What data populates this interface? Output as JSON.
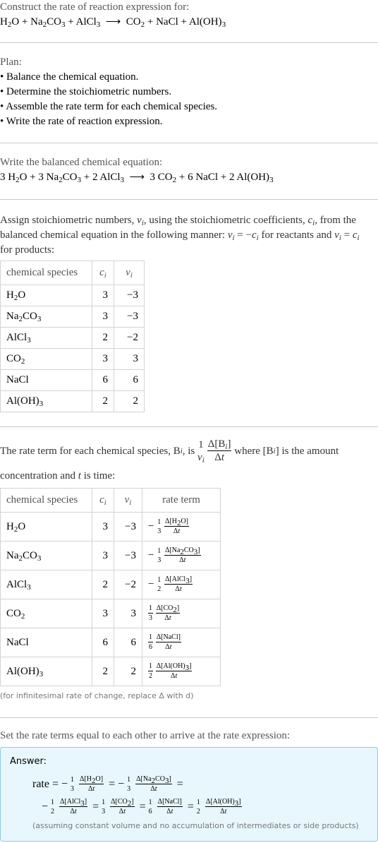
{
  "header": {
    "title": "Construct the rate of reaction expression for:",
    "reaction": {
      "reactants": [
        "H2O",
        "Na2CO3",
        "AlCl3"
      ],
      "products": [
        "CO2",
        "NaCl",
        "Al(OH)3"
      ],
      "arrow": "⟶"
    }
  },
  "plan": {
    "label": "Plan:",
    "steps": [
      "Balance the chemical equation.",
      "Determine the stoichiometric numbers.",
      "Assemble the rate term for each chemical species.",
      "Write the rate of reaction expression."
    ]
  },
  "balanced": {
    "label": "Write the balanced chemical equation:",
    "equation": "3 H2O + 3 Na2CO3 + 2 AlCl3 ⟶ 3 CO2 + 6 NaCl + 2 Al(OH)3"
  },
  "stoich": {
    "intro": "Assign stoichiometric numbers, νi, using the stoichiometric coefficients, ci, from the balanced chemical equation in the following manner: νi = −ci for reactants and νi = ci for products:",
    "headers": [
      "chemical species",
      "ci",
      "νi"
    ],
    "rows": [
      {
        "species": "H2O",
        "c": "3",
        "nu": "−3"
      },
      {
        "species": "Na2CO3",
        "c": "3",
        "nu": "−3"
      },
      {
        "species": "AlCl3",
        "c": "2",
        "nu": "−2"
      },
      {
        "species": "CO2",
        "c": "3",
        "nu": "3"
      },
      {
        "species": "NaCl",
        "c": "6",
        "nu": "6"
      },
      {
        "species": "Al(OH)3",
        "c": "2",
        "nu": "2"
      }
    ]
  },
  "rate_terms": {
    "intro_a": "The rate term for each chemical species, Bi, is",
    "intro_b": "where [Bi] is the amount concentration and t is time:",
    "headers": [
      "chemical species",
      "ci",
      "νi",
      "rate term"
    ],
    "rows": [
      {
        "species": "H2O",
        "c": "3",
        "nu": "−3",
        "sign": "−",
        "den": "3"
      },
      {
        "species": "Na2CO3",
        "c": "3",
        "nu": "−3",
        "sign": "−",
        "den": "3"
      },
      {
        "species": "AlCl3",
        "c": "2",
        "nu": "−2",
        "sign": "−",
        "den": "2"
      },
      {
        "species": "CO2",
        "c": "3",
        "nu": "3",
        "sign": "",
        "den": "3"
      },
      {
        "species": "NaCl",
        "c": "6",
        "nu": "6",
        "sign": "",
        "den": "6"
      },
      {
        "species": "Al(OH)3",
        "c": "2",
        "nu": "2",
        "sign": "",
        "den": "2"
      }
    ],
    "note": "(for infinitesimal rate of change, replace Δ with d)"
  },
  "final": {
    "intro": "Set the rate terms equal to each other to arrive at the rate expression:",
    "answer_label": "Answer:",
    "rate_word": "rate",
    "assumption": "(assuming constant volume and no accumulation of intermediates or side products)"
  },
  "colors": {
    "answer_bg": "#e8f7fd",
    "answer_border": "#8ecbe0",
    "rule": "#c8c8c8",
    "table_border": "#d3d3d3"
  }
}
